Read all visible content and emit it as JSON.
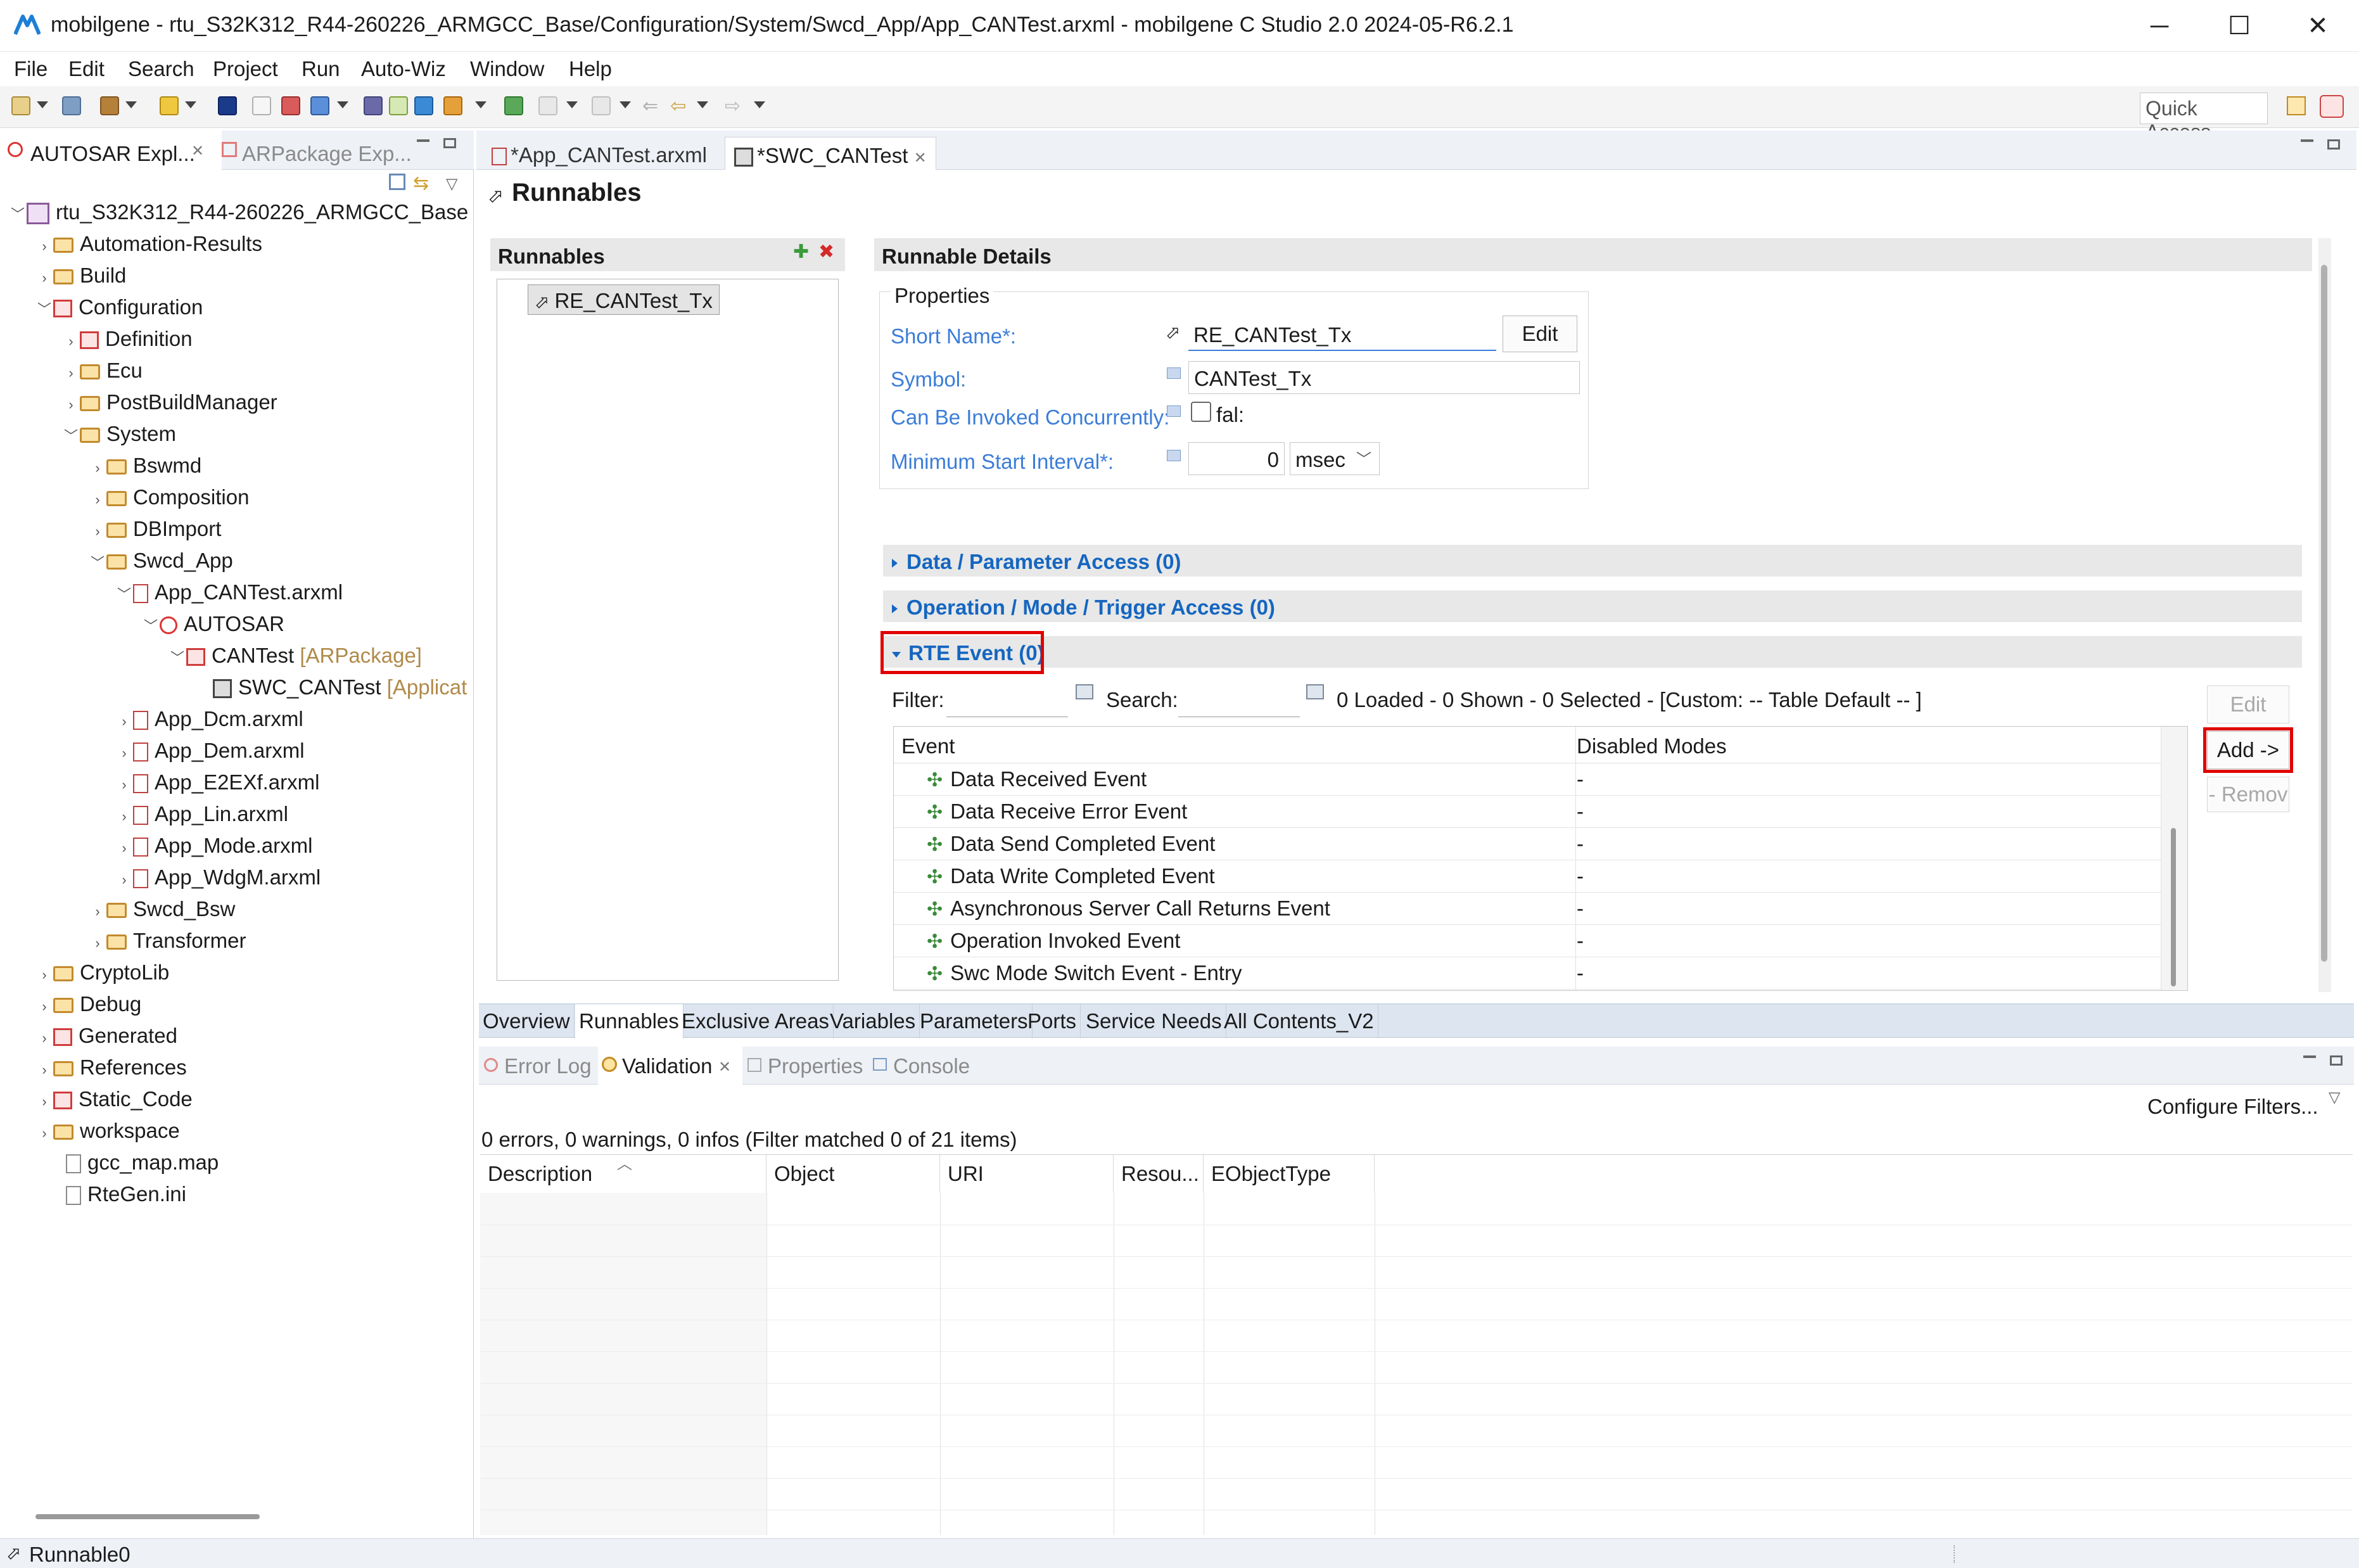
{
  "window": {
    "title": "mobilgene - rtu_S32K312_R44-260226_ARMGCC_Base/Configuration/System/Swcd_App/App_CANTest.arxml - mobilgene C Studio 2.0 2024-05-R6.2.1",
    "minimize": "─",
    "maximize": "☐",
    "close": "✕"
  },
  "menu": [
    "File",
    "Edit",
    "Search",
    "Project",
    "Run",
    "Auto-Wiz",
    "Window",
    "Help"
  ],
  "toolbar": {
    "quick_access": "Quick Access"
  },
  "left_panel": {
    "tabs": [
      {
        "label": "AUTOSAR Expl...",
        "close": "✕"
      },
      {
        "label": "ARPackage Exp...",
        "close": ""
      }
    ],
    "tree": [
      {
        "label": "rtu_S32K312_R44-260226_ARMGCC_Base",
        "annotation": "",
        "icon": "project-icon",
        "expanded": true
      },
      {
        "label": "Automation-Results",
        "annotation": "",
        "icon": "folder-icon"
      },
      {
        "label": "Build",
        "annotation": "",
        "icon": "folder-icon"
      },
      {
        "label": "Configuration",
        "annotation": "",
        "icon": "package-icon",
        "expanded": true
      },
      {
        "label": "Definition",
        "annotation": "",
        "icon": "package-icon"
      },
      {
        "label": "Ecu",
        "annotation": "",
        "icon": "folder-icon"
      },
      {
        "label": "PostBuildManager",
        "annotation": "",
        "icon": "folder-icon"
      },
      {
        "label": "System",
        "annotation": "",
        "icon": "folder-icon",
        "expanded": true
      },
      {
        "label": "Bswmd",
        "annotation": "",
        "icon": "folder-icon"
      },
      {
        "label": "Composition",
        "annotation": "",
        "icon": "folder-icon"
      },
      {
        "label": "DBImport",
        "annotation": "",
        "icon": "folder-icon"
      },
      {
        "label": "Swcd_App",
        "annotation": "",
        "icon": "folder-icon",
        "expanded": true
      },
      {
        "label": "App_CANTest.arxml",
        "annotation": "",
        "icon": "arxml-icon",
        "expanded": true
      },
      {
        "label": "AUTOSAR",
        "annotation": "",
        "icon": "autosar-icon",
        "expanded": true
      },
      {
        "label": "CANTest",
        "annotation": "[ARPackage]",
        "icon": "arpackage-icon",
        "expanded": true
      },
      {
        "label": "SWC_CANTest",
        "annotation": "[Applicat",
        "icon": "swc-icon"
      },
      {
        "label": "App_Dcm.arxml",
        "annotation": "",
        "icon": "arxml-icon"
      },
      {
        "label": "App_Dem.arxml",
        "annotation": "",
        "icon": "arxml-icon"
      },
      {
        "label": "App_E2EXf.arxml",
        "annotation": "",
        "icon": "arxml-icon"
      },
      {
        "label": "App_Lin.arxml",
        "annotation": "",
        "icon": "arxml-icon"
      },
      {
        "label": "App_Mode.arxml",
        "annotation": "",
        "icon": "arxml-icon"
      },
      {
        "label": "App_WdgM.arxml",
        "annotation": "",
        "icon": "arxml-icon"
      },
      {
        "label": "Swcd_Bsw",
        "annotation": "",
        "icon": "folder-icon"
      },
      {
        "label": "Transformer",
        "annotation": "",
        "icon": "folder-icon"
      },
      {
        "label": "CryptoLib",
        "annotation": "",
        "icon": "folder-icon"
      },
      {
        "label": "Debug",
        "annotation": "",
        "icon": "folder-icon"
      },
      {
        "label": "Generated",
        "annotation": "",
        "icon": "package-icon"
      },
      {
        "label": "References",
        "annotation": "",
        "icon": "folder-icon"
      },
      {
        "label": "Static_Code",
        "annotation": "",
        "icon": "package-icon"
      },
      {
        "label": "workspace",
        "annotation": "",
        "icon": "folder-icon"
      },
      {
        "label": "gcc_map.map",
        "annotation": "",
        "icon": "file-icon"
      },
      {
        "label": "RteGen.ini",
        "annotation": "",
        "icon": "file-icon"
      }
    ]
  },
  "editor": {
    "tabs": [
      {
        "label": "*App_CANTest.arxml",
        "close": "",
        "active": false
      },
      {
        "label": "*SWC_CANTest",
        "close": "✕",
        "active": true
      }
    ],
    "page_title": "Runnables",
    "runnables_section": {
      "title": "Runnables",
      "add_icon": "✚",
      "remove_icon": "✖",
      "items": [
        "RE_CANTest_Tx"
      ]
    },
    "details": {
      "title": "Runnable Details",
      "properties_label": "Properties",
      "short_name_label": "Short Name*:",
      "short_name_value": "RE_CANTest_Tx",
      "edit_label": "Edit",
      "symbol_label": "Symbol:",
      "symbol_value": "CANTest_Tx",
      "concurrent_label": "Can Be Invoked Concurrently:",
      "concurrent_value": "fal:",
      "min_interval_label": "Minimum Start Interval*:",
      "min_interval_value": "0",
      "min_interval_unit": "msec"
    },
    "sections": {
      "data_access": "Data / Parameter Access (0)",
      "operation_access": "Operation / Mode / Trigger Access (0)",
      "rte_event": "RTE Event (0)"
    },
    "rte": {
      "filter_label": "Filter:",
      "search_label": "Search:",
      "status": "0 Loaded - 0 Shown - 0 Selected -  [Custom: -- Table Default -- ]",
      "columns": [
        "Event",
        "Disabled Modes"
      ],
      "rows": [
        {
          "event": "Data Received Event",
          "modes": "-"
        },
        {
          "event": "Data Receive Error Event",
          "modes": "-"
        },
        {
          "event": "Data Send Completed Event",
          "modes": "-"
        },
        {
          "event": "Data Write Completed Event",
          "modes": "-"
        },
        {
          "event": "Asynchronous Server Call Returns Event",
          "modes": "-"
        },
        {
          "event": "Operation Invoked Event",
          "modes": "-"
        },
        {
          "event": "Swc Mode Switch Event - Entry",
          "modes": "-"
        }
      ],
      "edit_btn": "Edit",
      "add_btn": "Add ->",
      "remove_btn": "- Remov"
    },
    "page_tabs": [
      "Overview",
      "Runnables",
      "Exclusive Areas",
      "Variables",
      "Parameters",
      "Ports",
      "Service Needs",
      "All Contents_V2"
    ]
  },
  "bottom_panel": {
    "tabs": [
      {
        "label": "Error Log",
        "active": false,
        "close": ""
      },
      {
        "label": "Validation",
        "active": true,
        "close": "✕"
      },
      {
        "label": "Properties",
        "active": false,
        "close": ""
      },
      {
        "label": "Console",
        "active": false,
        "close": ""
      }
    ],
    "configure_filters": "Configure Filters...",
    "summary": "0 errors, 0 warnings, 0 infos (Filter matched 0 of 21 items)",
    "columns": [
      "Description",
      "Object",
      "URI",
      "Resou...",
      "EObjectType"
    ]
  },
  "status_bar": {
    "text": "Runnable0"
  },
  "colors": {
    "accent_blue": "#1566c0",
    "label_blue": "#3b7dd8",
    "highlight_red": "#e00000"
  }
}
